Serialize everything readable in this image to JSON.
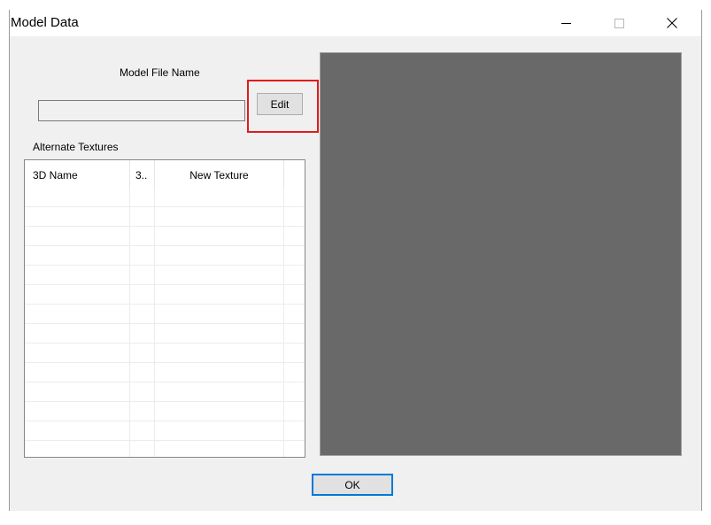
{
  "window": {
    "title": "Model Data",
    "controls": {
      "minimize_icon": "minimize-icon",
      "maximize_icon": "maximize-icon",
      "close_icon": "close-icon"
    }
  },
  "model_file": {
    "label": "Model File Name",
    "value": "",
    "edit_label": "Edit",
    "highlight_color": "#e01b1b"
  },
  "alternate_textures": {
    "label": "Alternate Textures",
    "columns": [
      "3D Name",
      "3..",
      "New Texture"
    ],
    "rows": []
  },
  "preview": {
    "background_color": "#696969"
  },
  "footer": {
    "ok_label": "OK",
    "focus_color": "#0078d7"
  }
}
